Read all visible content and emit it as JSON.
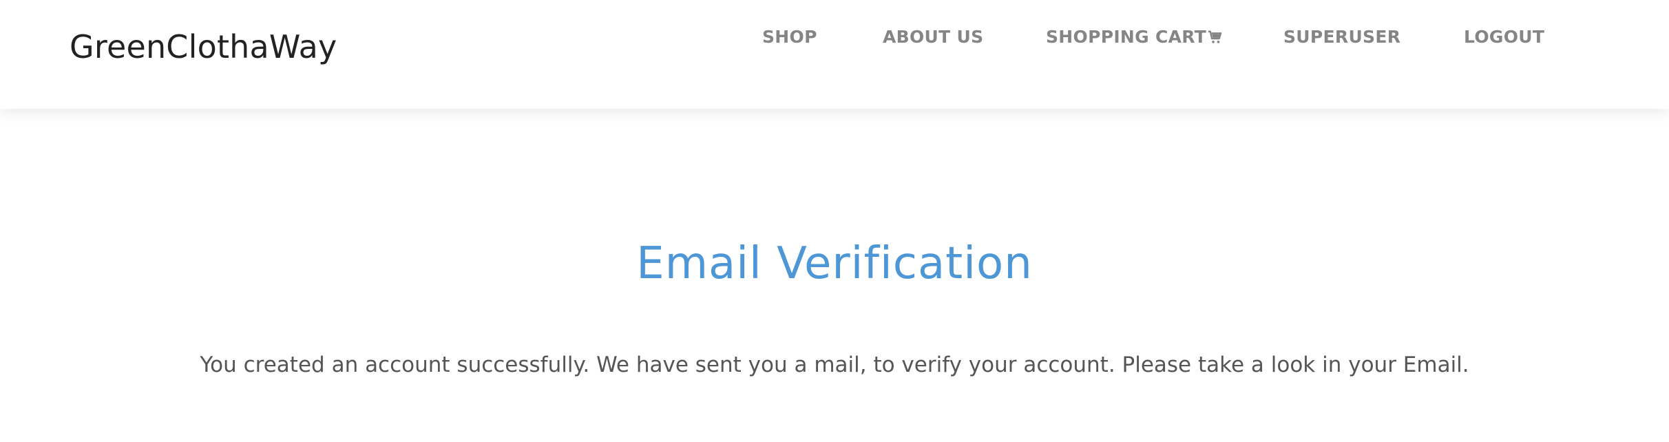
{
  "header": {
    "brand": "GreenClothaWay",
    "nav": {
      "shop": "SHOP",
      "about": "ABOUT US",
      "cart": "SHOPPING CART",
      "superuser": "SUPERUSER",
      "logout": "LOGOUT"
    },
    "cart_icon": "shopping-cart-icon"
  },
  "main": {
    "title": "Email Verification",
    "message": "You created an account successfully. We have sent you a mail, to verify your account. Please take a look in your Email."
  },
  "colors": {
    "title": "#4e97d6",
    "nav_text": "#858585",
    "brand_text": "#222222",
    "body_text": "#555555",
    "background": "#ffffff"
  }
}
